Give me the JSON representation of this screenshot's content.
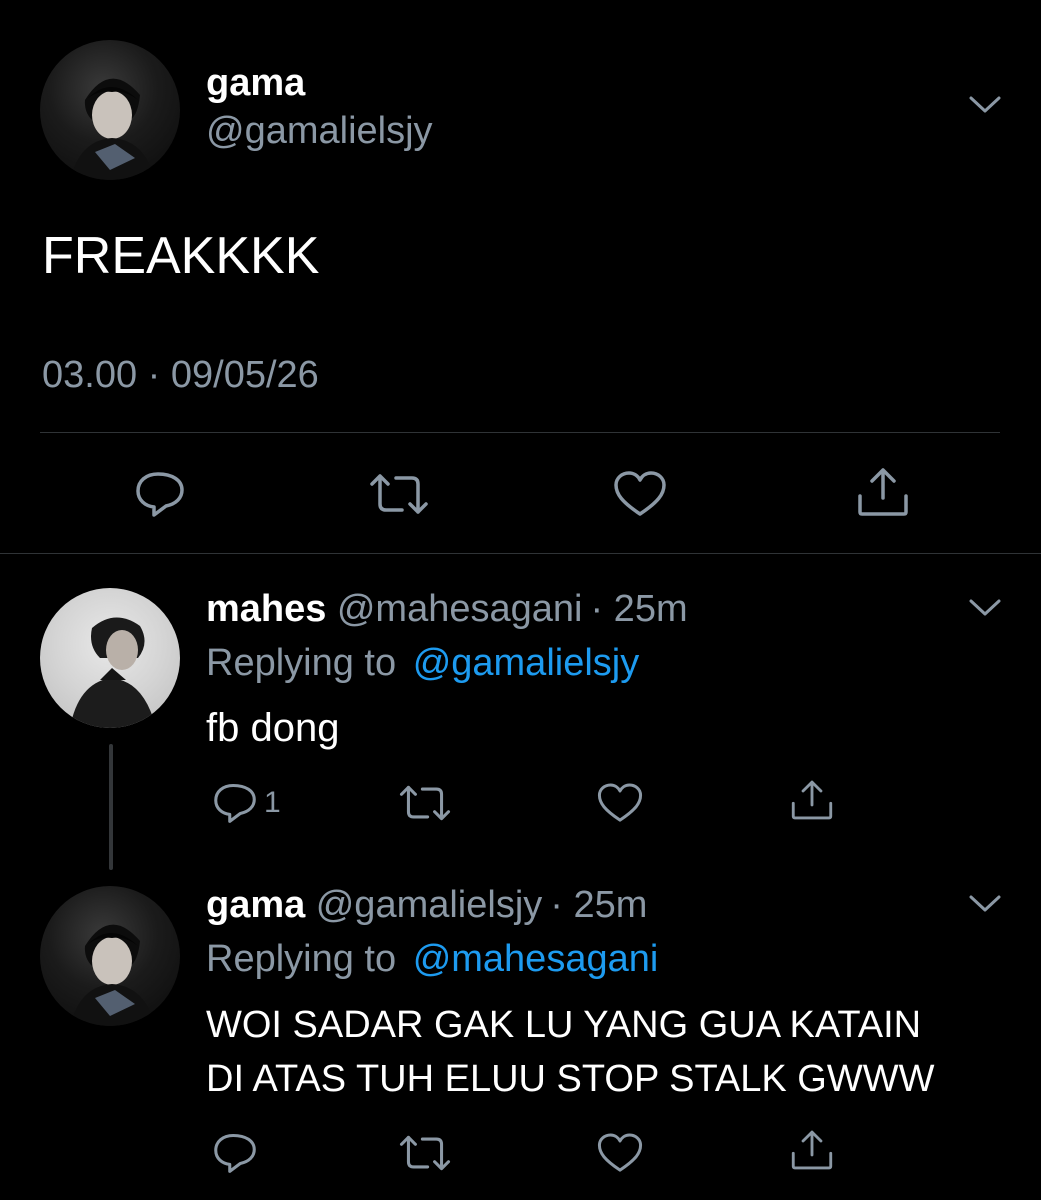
{
  "main_tweet": {
    "name": "gama",
    "handle": "@gamalielsjy",
    "text": "FREAKKKK",
    "timestamp": "03.00 · 09/05/26"
  },
  "replies": [
    {
      "name": "mahes",
      "handle": "@mahesagani",
      "time": "· 25m",
      "replying_label": "Replying to",
      "replying_to": "@gamalielsjy",
      "text": "fb dong",
      "reply_count": "1"
    },
    {
      "name": "gama",
      "handle": "@gamalielsjy",
      "time": "· 25m",
      "replying_label": "Replying to",
      "replying_to": "@mahesagani",
      "text_line1": "WOI SADAR GAK LU YANG GUA KATAIN",
      "text_line2": "DI ATAS TUH ELUU STOP STALK GWWW"
    }
  ],
  "colors": {
    "background": "#000000",
    "text": "#ffffff",
    "muted": "#8b98a5",
    "link": "#1d9bf0",
    "divider": "#2f3336"
  },
  "icons": [
    "reply-icon",
    "retweet-icon",
    "like-icon",
    "share-icon",
    "chevron-down-icon"
  ]
}
